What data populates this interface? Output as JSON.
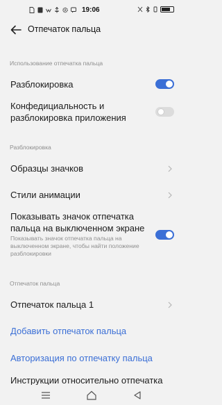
{
  "status": {
    "time": "19:06",
    "battery_level": 0.75
  },
  "header": {
    "title": "Отпечаток пальца"
  },
  "sections": {
    "usage": "Использование отпечатка пальца",
    "unlock": "Разблокировка",
    "fingerprints": "Отпечаток пальца"
  },
  "items": {
    "unlock": {
      "label": "Разблокировка",
      "enabled": true
    },
    "privacy": {
      "label": "Конфедициальность и разблокировка приложения",
      "enabled": false
    },
    "icon_styles": {
      "label": "Образцы значков"
    },
    "animation_styles": {
      "label": "Стили анимации"
    },
    "show_icon": {
      "label": "Показывать значок отпечатка пальца на выключенном экране",
      "sub": "Показывать значок отпечатка пальца на выключенном экране, чтобы найти положение разблокировки",
      "enabled": true
    },
    "fingerprint1": {
      "label": "Отпечаток пальца 1"
    },
    "add_fingerprint": {
      "label": "Добавить отпечаток пальца"
    },
    "auth": {
      "label": "Авторизация по отпечатку пальца"
    },
    "instructions": {
      "label": "Инструкции относительно отпечатка"
    }
  },
  "colors": {
    "accent": "#3b6fd6",
    "background": "#f2f2f2"
  }
}
